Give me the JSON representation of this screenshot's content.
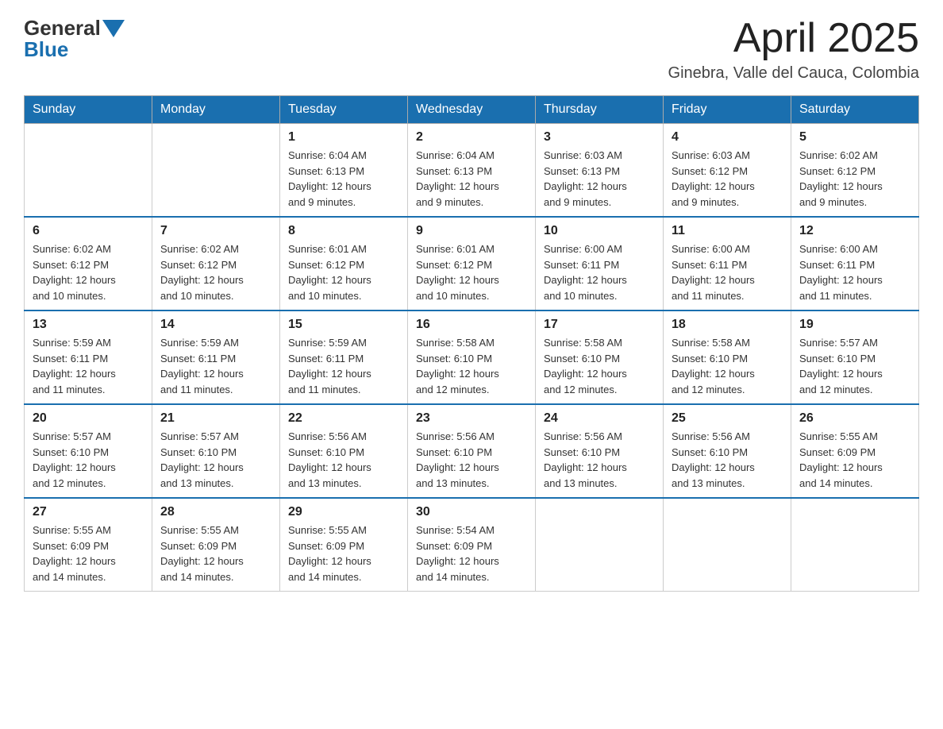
{
  "header": {
    "logo_general": "General",
    "logo_blue": "Blue",
    "month_year": "April 2025",
    "location": "Ginebra, Valle del Cauca, Colombia"
  },
  "weekdays": [
    "Sunday",
    "Monday",
    "Tuesday",
    "Wednesday",
    "Thursday",
    "Friday",
    "Saturday"
  ],
  "weeks": [
    [
      {
        "day": "",
        "info": ""
      },
      {
        "day": "",
        "info": ""
      },
      {
        "day": "1",
        "info": "Sunrise: 6:04 AM\nSunset: 6:13 PM\nDaylight: 12 hours\nand 9 minutes."
      },
      {
        "day": "2",
        "info": "Sunrise: 6:04 AM\nSunset: 6:13 PM\nDaylight: 12 hours\nand 9 minutes."
      },
      {
        "day": "3",
        "info": "Sunrise: 6:03 AM\nSunset: 6:13 PM\nDaylight: 12 hours\nand 9 minutes."
      },
      {
        "day": "4",
        "info": "Sunrise: 6:03 AM\nSunset: 6:12 PM\nDaylight: 12 hours\nand 9 minutes."
      },
      {
        "day": "5",
        "info": "Sunrise: 6:02 AM\nSunset: 6:12 PM\nDaylight: 12 hours\nand 9 minutes."
      }
    ],
    [
      {
        "day": "6",
        "info": "Sunrise: 6:02 AM\nSunset: 6:12 PM\nDaylight: 12 hours\nand 10 minutes."
      },
      {
        "day": "7",
        "info": "Sunrise: 6:02 AM\nSunset: 6:12 PM\nDaylight: 12 hours\nand 10 minutes."
      },
      {
        "day": "8",
        "info": "Sunrise: 6:01 AM\nSunset: 6:12 PM\nDaylight: 12 hours\nand 10 minutes."
      },
      {
        "day": "9",
        "info": "Sunrise: 6:01 AM\nSunset: 6:12 PM\nDaylight: 12 hours\nand 10 minutes."
      },
      {
        "day": "10",
        "info": "Sunrise: 6:00 AM\nSunset: 6:11 PM\nDaylight: 12 hours\nand 10 minutes."
      },
      {
        "day": "11",
        "info": "Sunrise: 6:00 AM\nSunset: 6:11 PM\nDaylight: 12 hours\nand 11 minutes."
      },
      {
        "day": "12",
        "info": "Sunrise: 6:00 AM\nSunset: 6:11 PM\nDaylight: 12 hours\nand 11 minutes."
      }
    ],
    [
      {
        "day": "13",
        "info": "Sunrise: 5:59 AM\nSunset: 6:11 PM\nDaylight: 12 hours\nand 11 minutes."
      },
      {
        "day": "14",
        "info": "Sunrise: 5:59 AM\nSunset: 6:11 PM\nDaylight: 12 hours\nand 11 minutes."
      },
      {
        "day": "15",
        "info": "Sunrise: 5:59 AM\nSunset: 6:11 PM\nDaylight: 12 hours\nand 11 minutes."
      },
      {
        "day": "16",
        "info": "Sunrise: 5:58 AM\nSunset: 6:10 PM\nDaylight: 12 hours\nand 12 minutes."
      },
      {
        "day": "17",
        "info": "Sunrise: 5:58 AM\nSunset: 6:10 PM\nDaylight: 12 hours\nand 12 minutes."
      },
      {
        "day": "18",
        "info": "Sunrise: 5:58 AM\nSunset: 6:10 PM\nDaylight: 12 hours\nand 12 minutes."
      },
      {
        "day": "19",
        "info": "Sunrise: 5:57 AM\nSunset: 6:10 PM\nDaylight: 12 hours\nand 12 minutes."
      }
    ],
    [
      {
        "day": "20",
        "info": "Sunrise: 5:57 AM\nSunset: 6:10 PM\nDaylight: 12 hours\nand 12 minutes."
      },
      {
        "day": "21",
        "info": "Sunrise: 5:57 AM\nSunset: 6:10 PM\nDaylight: 12 hours\nand 13 minutes."
      },
      {
        "day": "22",
        "info": "Sunrise: 5:56 AM\nSunset: 6:10 PM\nDaylight: 12 hours\nand 13 minutes."
      },
      {
        "day": "23",
        "info": "Sunrise: 5:56 AM\nSunset: 6:10 PM\nDaylight: 12 hours\nand 13 minutes."
      },
      {
        "day": "24",
        "info": "Sunrise: 5:56 AM\nSunset: 6:10 PM\nDaylight: 12 hours\nand 13 minutes."
      },
      {
        "day": "25",
        "info": "Sunrise: 5:56 AM\nSunset: 6:10 PM\nDaylight: 12 hours\nand 13 minutes."
      },
      {
        "day": "26",
        "info": "Sunrise: 5:55 AM\nSunset: 6:09 PM\nDaylight: 12 hours\nand 14 minutes."
      }
    ],
    [
      {
        "day": "27",
        "info": "Sunrise: 5:55 AM\nSunset: 6:09 PM\nDaylight: 12 hours\nand 14 minutes."
      },
      {
        "day": "28",
        "info": "Sunrise: 5:55 AM\nSunset: 6:09 PM\nDaylight: 12 hours\nand 14 minutes."
      },
      {
        "day": "29",
        "info": "Sunrise: 5:55 AM\nSunset: 6:09 PM\nDaylight: 12 hours\nand 14 minutes."
      },
      {
        "day": "30",
        "info": "Sunrise: 5:54 AM\nSunset: 6:09 PM\nDaylight: 12 hours\nand 14 minutes."
      },
      {
        "day": "",
        "info": ""
      },
      {
        "day": "",
        "info": ""
      },
      {
        "day": "",
        "info": ""
      }
    ]
  ]
}
